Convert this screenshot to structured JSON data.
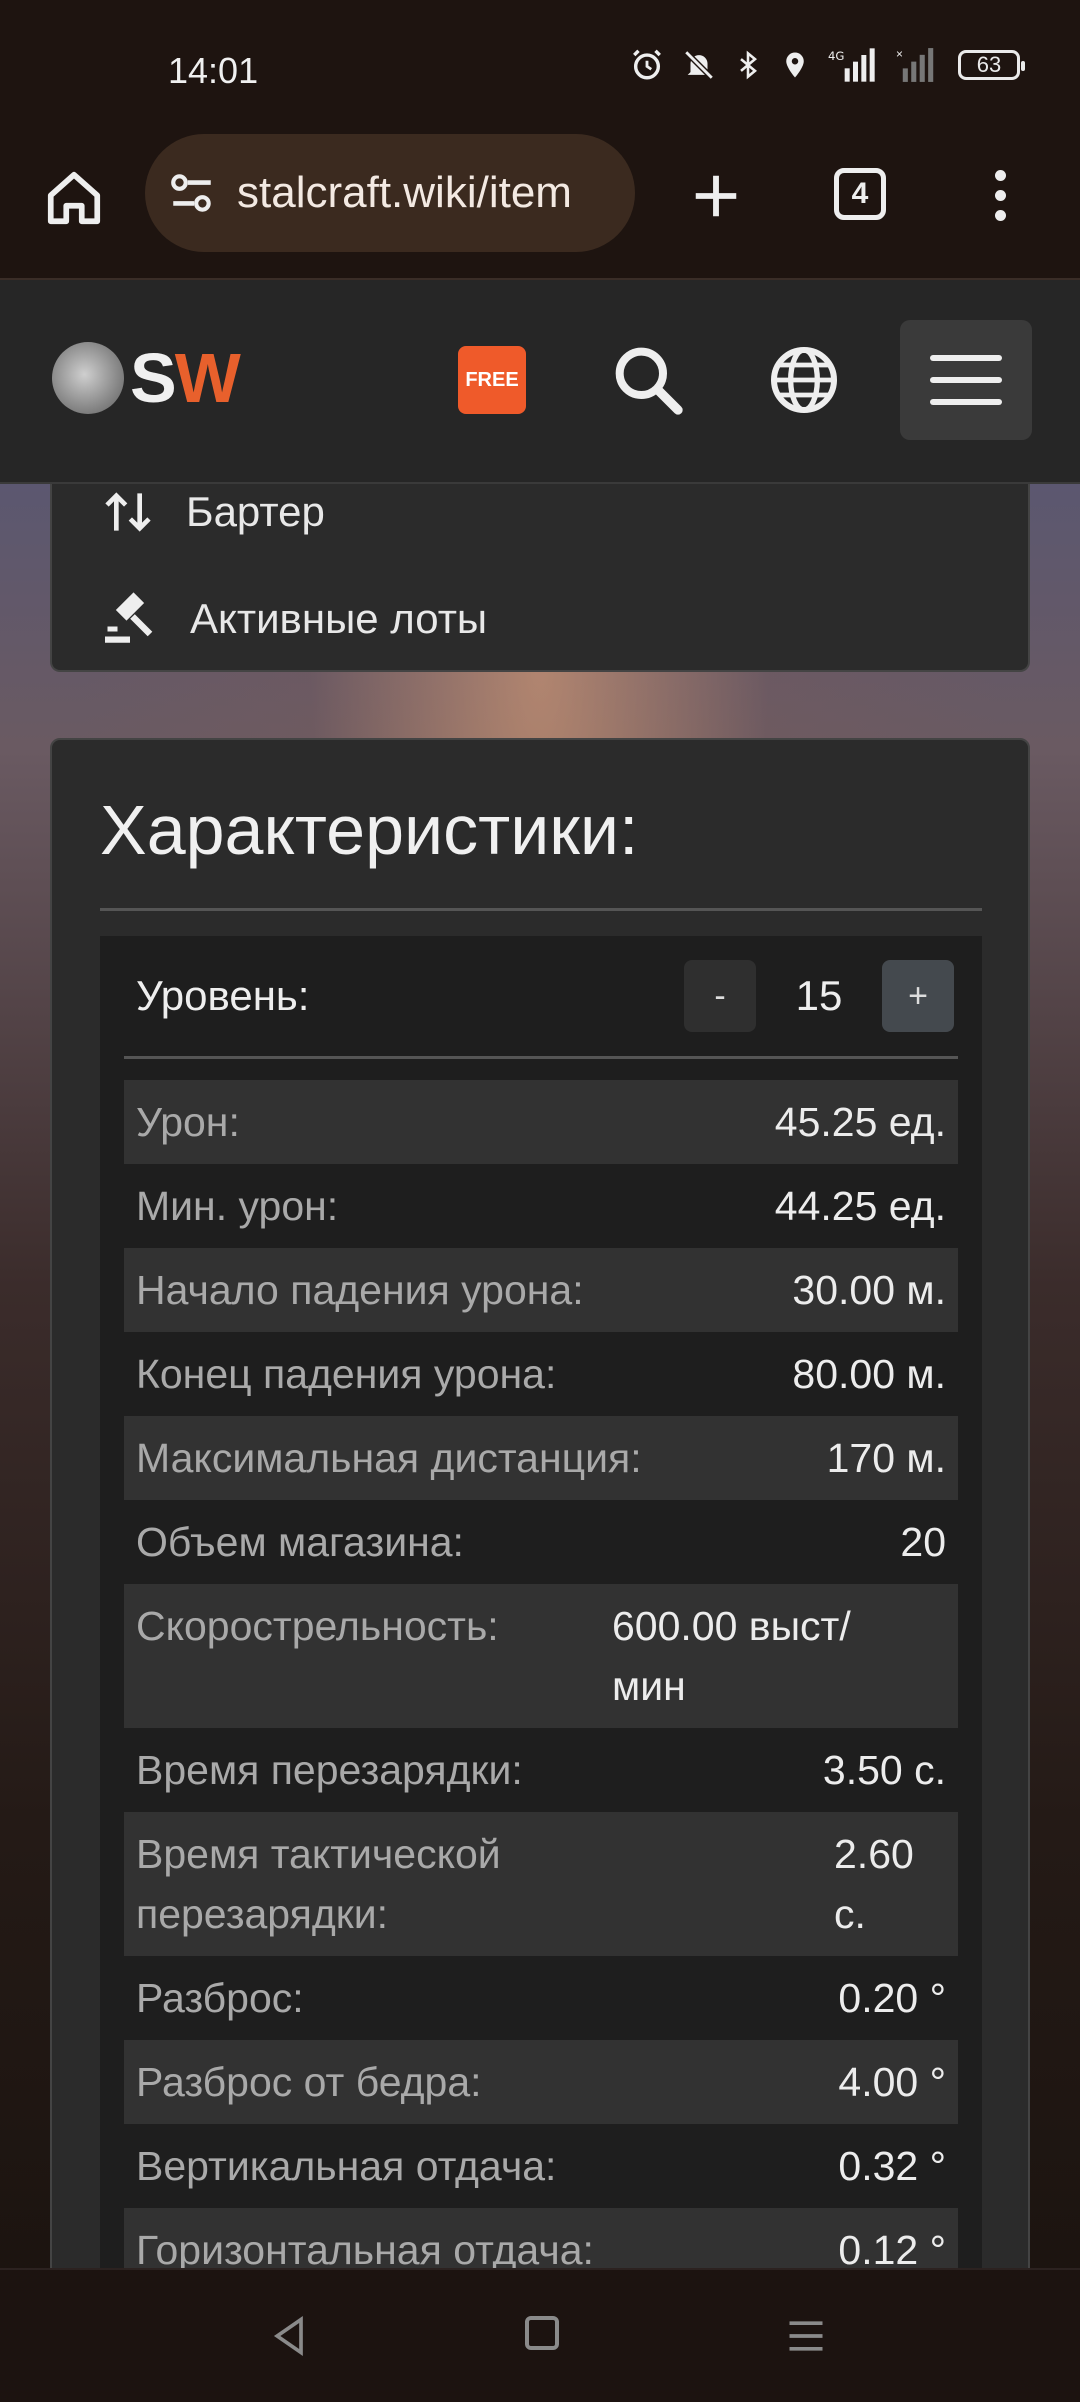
{
  "status_bar": {
    "time": "14:01",
    "battery": "63",
    "network": "4G",
    "icons": [
      "alarm-icon",
      "mute-icon",
      "bluetooth-icon",
      "location-icon",
      "signal-icon",
      "signal-2-icon",
      "battery-icon"
    ]
  },
  "browser": {
    "url": "stalcraft.wiki/item",
    "tab_count": "4"
  },
  "site_header": {
    "logo_s": "S",
    "logo_w": "W",
    "free_badge": "FREE"
  },
  "side_menu": {
    "items": [
      {
        "label": "Бартер",
        "icon": "swap-vertical-icon"
      },
      {
        "label": "Активные лоты",
        "icon": "auction-hammer-icon"
      }
    ]
  },
  "specs": {
    "title": "Характеристики:",
    "level_label": "Уровень:",
    "level_minus": "-",
    "level_value": "15",
    "level_plus": "+",
    "rows": [
      {
        "key": "Урон:",
        "value": "45.25 ед."
      },
      {
        "key": "Мин. урон:",
        "value": "44.25 ед."
      },
      {
        "key": "Начало падения урона:",
        "value": "30.00 м."
      },
      {
        "key": "Конец падения урона:",
        "value": "80.00 м."
      },
      {
        "key": "Максимальная дистанция:",
        "value": "170 м."
      },
      {
        "key": "Объем магазина:",
        "value": "20"
      },
      {
        "key": "Скорострельность:",
        "value": "600.00 выст/\nмин"
      },
      {
        "key": "Время перезарядки:",
        "value": "3.50 с."
      },
      {
        "key": "Время тактической\nперезарядки:",
        "value": "2.60\nс."
      },
      {
        "key": "Разброс:",
        "value": "0.20 °"
      },
      {
        "key": "Разброс от бедра:",
        "value": "4.00 °"
      },
      {
        "key": "Вертикальная отдача:",
        "value": "0.32 °"
      },
      {
        "key": "Горизонтальная отдача:",
        "value": "0.12 °"
      }
    ]
  },
  "colors": {
    "accent": "#e8602c",
    "panel_bg": "#2b2b2b",
    "row_alt": "#323232",
    "inner_bg": "#1e1e1e"
  }
}
